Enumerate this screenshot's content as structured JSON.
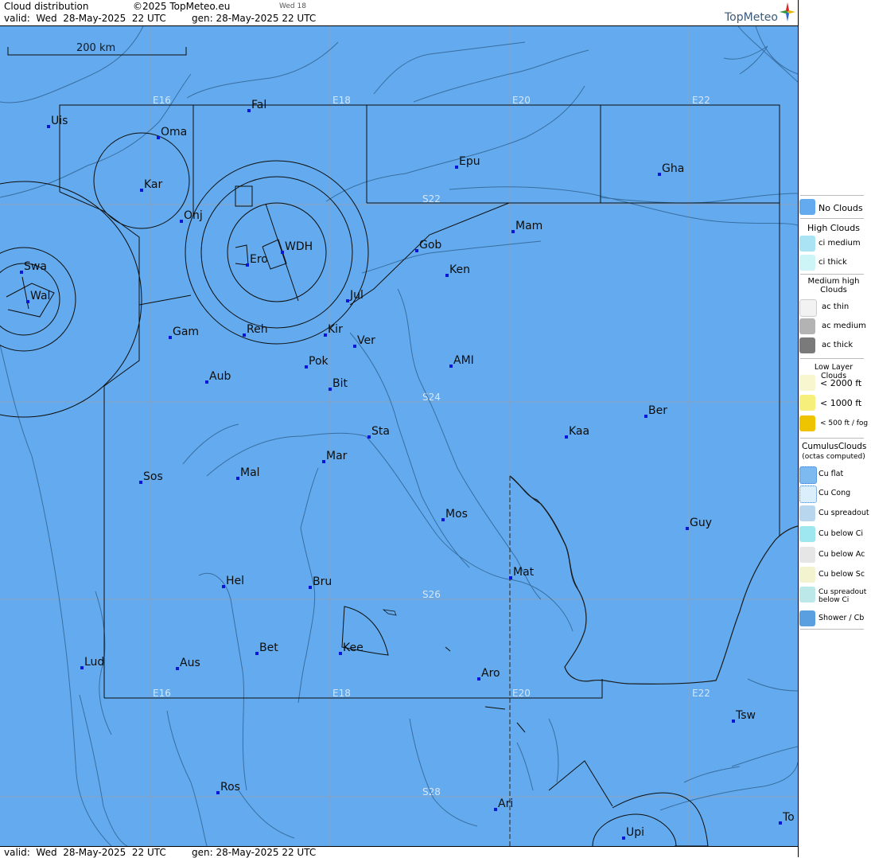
{
  "header": {
    "title": "Cloud distribution",
    "copyright": "©2025 TopMeteo.eu",
    "day_tab": "Wed 18",
    "valid": "valid:  Wed  28-May-2025  22 UTC",
    "gen": "gen: 28-May-2025 22 UTC",
    "logo": "TopMeteo"
  },
  "footer": {
    "valid": "valid:  Wed  28-May-2025  22 UTC",
    "gen": "gen: 28-May-2025 22 UTC"
  },
  "map": {
    "scale_label": "200 km",
    "background_color": "#63abee",
    "longitude_labels": [
      "E16",
      "E18",
      "E20",
      "E22"
    ],
    "latitude_labels": [
      "S22",
      "S24",
      "S26",
      "S28"
    ],
    "places": [
      "Uis",
      "Fal",
      "Oma",
      "Kar",
      "Onj",
      "Epu",
      "Gha",
      "Mam",
      "Gob",
      "WDH",
      "Ero",
      "Swa",
      "Wal",
      "Ken",
      "Jul",
      "Gam",
      "Reh",
      "Kir",
      "Ver",
      "AMI",
      "Pok",
      "Aub",
      "Bit",
      "Ber",
      "Sta",
      "Kaa",
      "Mar",
      "Sos",
      "Mal",
      "Mos",
      "Guy",
      "Mat",
      "Hel",
      "Bru",
      "Bet",
      "Kee",
      "Lud",
      "Aus",
      "Aro",
      "Tsw",
      "Ros",
      "Ari",
      "To",
      "Upi"
    ]
  },
  "legend": {
    "no_clouds": "No Clouds",
    "high_title": "High Clouds",
    "ci_medium": "ci medium",
    "ci_thick": "ci thick",
    "medium_title": "Medium high Clouds",
    "ac_thin": "ac thin",
    "ac_medium": "ac medium",
    "ac_thick": "ac thick",
    "low_title": "Low Layer Clouds",
    "low_2000": "< 2000 ft",
    "low_1000": "< 1000 ft",
    "low_500": "< 500 ft / fog",
    "cu_title": "CumulusClouds",
    "cu_sub": "(octas computed)",
    "cu_flat": "Cu flat",
    "cu_cong": "Cu Cong",
    "cu_spreadout": "Cu spreadout",
    "cu_below_ci": "Cu below Ci",
    "cu_below_ac": "Cu below Ac",
    "cu_below_sc": "Cu below Sc",
    "cu_spreadout_below_ci": "Cu spreadout below Ci",
    "shower": "Shower / Cb"
  }
}
